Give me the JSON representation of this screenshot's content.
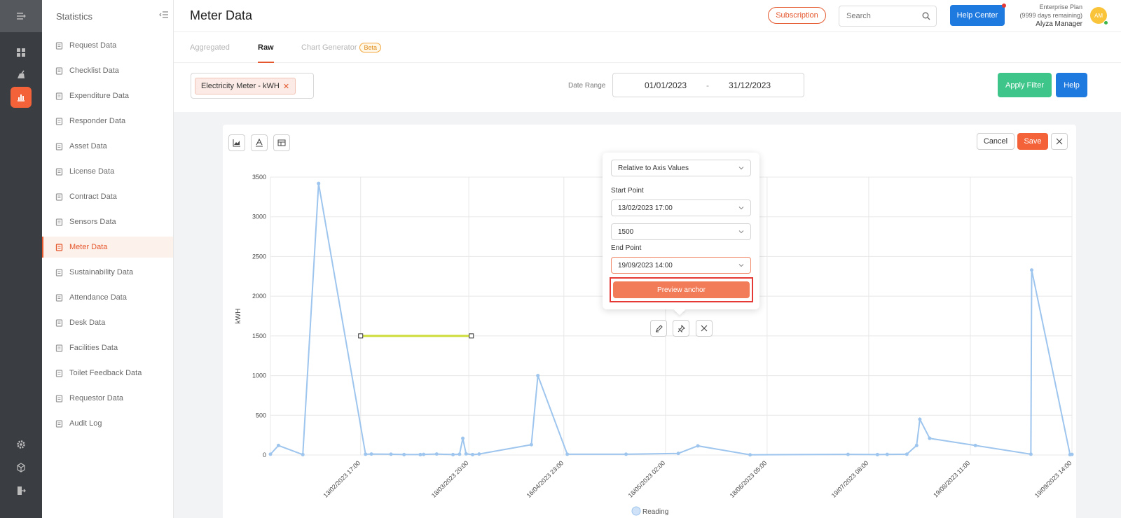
{
  "sidebar": {
    "title": "Statistics",
    "items": [
      {
        "label": "Request Data"
      },
      {
        "label": "Checklist Data"
      },
      {
        "label": "Expenditure Data"
      },
      {
        "label": "Responder Data"
      },
      {
        "label": "Asset Data"
      },
      {
        "label": "License Data"
      },
      {
        "label": "Contract Data"
      },
      {
        "label": "Sensors Data"
      },
      {
        "label": "Meter Data",
        "active": true
      },
      {
        "label": "Sustainability Data"
      },
      {
        "label": "Attendance Data"
      },
      {
        "label": "Desk Data"
      },
      {
        "label": "Facilities Data"
      },
      {
        "label": "Toilet Feedback Data"
      },
      {
        "label": "Requestor Data"
      },
      {
        "label": "Audit Log"
      }
    ]
  },
  "header": {
    "title": "Meter Data",
    "subscription_label": "Subscription",
    "search_placeholder": "Search",
    "help_center_label": "Help Center",
    "plan_name": "Enterprise Plan",
    "plan_remaining": "(9999 days remaining)",
    "user_name": "Alyza Manager",
    "avatar_initials": "AM"
  },
  "tabs": [
    {
      "label": "Aggregated"
    },
    {
      "label": "Raw",
      "active": true
    },
    {
      "label": "Chart Generator",
      "badge": "Beta"
    }
  ],
  "filter": {
    "selected_meter": "Electricity Meter - kWH",
    "date_range_label": "Date Range",
    "date_from": "01/01/2023",
    "date_sep": "-",
    "date_to": "31/12/2023",
    "apply_label": "Apply Filter",
    "help_label": "Help"
  },
  "chart_toolbar": {
    "cancel_label": "Cancel",
    "save_label": "Save"
  },
  "anchor_popover": {
    "mode": "Relative to Axis Values",
    "start_label": "Start Point",
    "start_x": "13/02/2023 17:00",
    "start_y": "1500",
    "end_label": "End Point",
    "end_x": "19/09/2023 14:00",
    "preview_label": "Preview anchor"
  },
  "chart_data": {
    "type": "line",
    "ylabel": "kWH",
    "ylim": [
      0,
      3500
    ],
    "yticks": [
      0,
      500,
      1000,
      1500,
      2000,
      2500,
      3000,
      3500
    ],
    "xlim": [
      "17/01/2023 02:00",
      "19/09/2023 14:00"
    ],
    "xticks": [
      "13/02/2023 17:00",
      "18/03/2023 20:00",
      "16/04/2023 23:00",
      "18/05/2023 02:00",
      "18/06/2023 05:00",
      "19/07/2023 08:00",
      "19/08/2023 11:00",
      "19/09/2023 14:00"
    ],
    "legend": [
      {
        "name": "Reading",
        "position": "bottom"
      }
    ],
    "series": [
      {
        "name": "Reading",
        "color": "#9ec5ee",
        "points": [
          [
            "17/01/2023 02:00",
            10
          ],
          [
            "19/01/2023 13:00",
            120
          ],
          [
            "27/01/2023 00:00",
            5
          ],
          [
            "31/01/2023 20:00",
            3420
          ],
          [
            "15/02/2023 05:00",
            10
          ],
          [
            "17/02/2023 00:00",
            12
          ],
          [
            "23/02/2023 00:00",
            10
          ],
          [
            "27/02/2023 00:00",
            5
          ],
          [
            "04/03/2023 00:00",
            5
          ],
          [
            "05/03/2023 00:00",
            8
          ],
          [
            "09/03/2023 00:00",
            12
          ],
          [
            "14/03/2023 00:00",
            5
          ],
          [
            "16/03/2023 00:00",
            10
          ],
          [
            "17/03/2023 00:00",
            210
          ],
          [
            "18/03/2023 00:00",
            15
          ],
          [
            "20/03/2023 00:00",
            5
          ],
          [
            "22/03/2023 00:00",
            12
          ],
          [
            "07/04/2023 00:00",
            130
          ],
          [
            "09/04/2023 00:00",
            1000
          ],
          [
            "18/04/2023 00:00",
            10
          ],
          [
            "06/05/2023 00:00",
            10
          ],
          [
            "22/05/2023 00:00",
            20
          ],
          [
            "28/05/2023 00:00",
            115
          ],
          [
            "13/06/2023 00:00",
            2
          ],
          [
            "13/07/2023 00:00",
            8
          ],
          [
            "22/07/2023 00:00",
            5
          ],
          [
            "25/07/2023 00:00",
            8
          ],
          [
            "31/07/2023 00:00",
            10
          ],
          [
            "03/08/2023 00:00",
            120
          ],
          [
            "04/08/2023 00:00",
            450
          ],
          [
            "07/08/2023 00:00",
            210
          ],
          [
            "21/08/2023 00:00",
            120
          ],
          [
            "07/09/2023 00:00",
            10
          ],
          [
            "07/09/2023 06:00",
            2330
          ],
          [
            "19/09/2023 00:00",
            5
          ],
          [
            "19/09/2023 14:00",
            8
          ]
        ]
      }
    ],
    "annotation": {
      "type": "anchor-line",
      "color": "#cddc39",
      "x_start": "13/02/2023 17:00",
      "x_end": "19/09/2023 14:00",
      "y": 1500
    }
  },
  "colors": {
    "accent": "#f4623a",
    "primary": "#1f7ae0",
    "success": "#3ec68a",
    "series": "#9ec5ee",
    "anchor": "#cddc39"
  }
}
